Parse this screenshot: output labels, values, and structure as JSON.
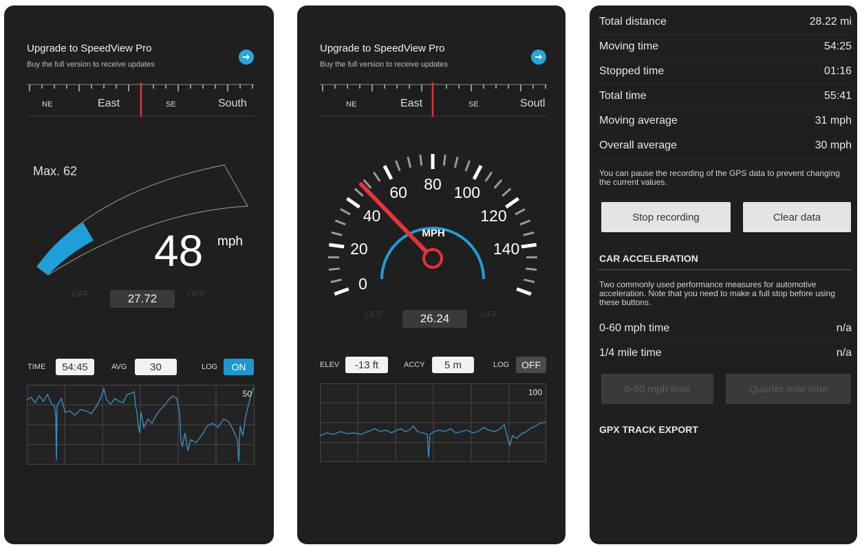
{
  "banner": {
    "title": "Upgrade to SpeedView Pro",
    "subtitle": "Buy the full version to receive updates",
    "icon": "arrow-right-icon"
  },
  "compass": {
    "ne": "NE",
    "east": "East",
    "se": "SE",
    "south": "South",
    "south_cropped": "Soutl"
  },
  "off_label": "OFF",
  "phone1": {
    "max_label": "Max. 62",
    "speed": "48",
    "speed_unit": "mph",
    "speed_fraction": 0.3,
    "odometer": "27.72",
    "time_label": "TIME",
    "time_value": "54:45",
    "avg_label": "AVG",
    "avg_value": "30",
    "log_label": "LOG",
    "log_state": "ON",
    "graph_max": "50"
  },
  "phone2": {
    "gauge_unit": "MPH",
    "gauge_labels": [
      "0",
      "20",
      "40",
      "60",
      "80",
      "100",
      "120",
      "140"
    ],
    "needle_speed": 48,
    "odometer": "26.24",
    "elev_label": "ELEV",
    "elev_value": "-13 ft",
    "accy_label": "ACCY",
    "accy_value": "5 m",
    "log_label": "LOG",
    "log_state": "OFF",
    "graph_max": "100"
  },
  "phone3": {
    "stats": [
      {
        "label": "Total distance",
        "value": "28.22 mi"
      },
      {
        "label": "Moving time",
        "value": "54:25"
      },
      {
        "label": "Stopped time",
        "value": "01:16"
      },
      {
        "label": "Total time",
        "value": "55:41"
      },
      {
        "label": "Moving average",
        "value": "31 mph"
      },
      {
        "label": "Overall average",
        "value": "30 mph"
      }
    ],
    "pause_note": "You can pause the recording of the GPS data to prevent changing the current values.",
    "stop_button": "Stop recording",
    "clear_button": "Clear data",
    "accel_heading": "CAR ACCELERATION",
    "accel_note": "Two commonly used performance measures for automotive acceleration. Note that you need to make a full stop before using these buttons.",
    "accel_rows": [
      {
        "label": "0-60 mph time",
        "value": "n/a"
      },
      {
        "label": "1/4 mile time",
        "value": "n/a"
      }
    ],
    "btn_060": "0-60 mph time",
    "btn_quarter": "Quarter mile time",
    "gpx_heading": "GPX TRACK EXPORT"
  },
  "colors": {
    "accent": "#1f97cf",
    "needle": "#e8323c",
    "background": "#1f1f1f"
  }
}
